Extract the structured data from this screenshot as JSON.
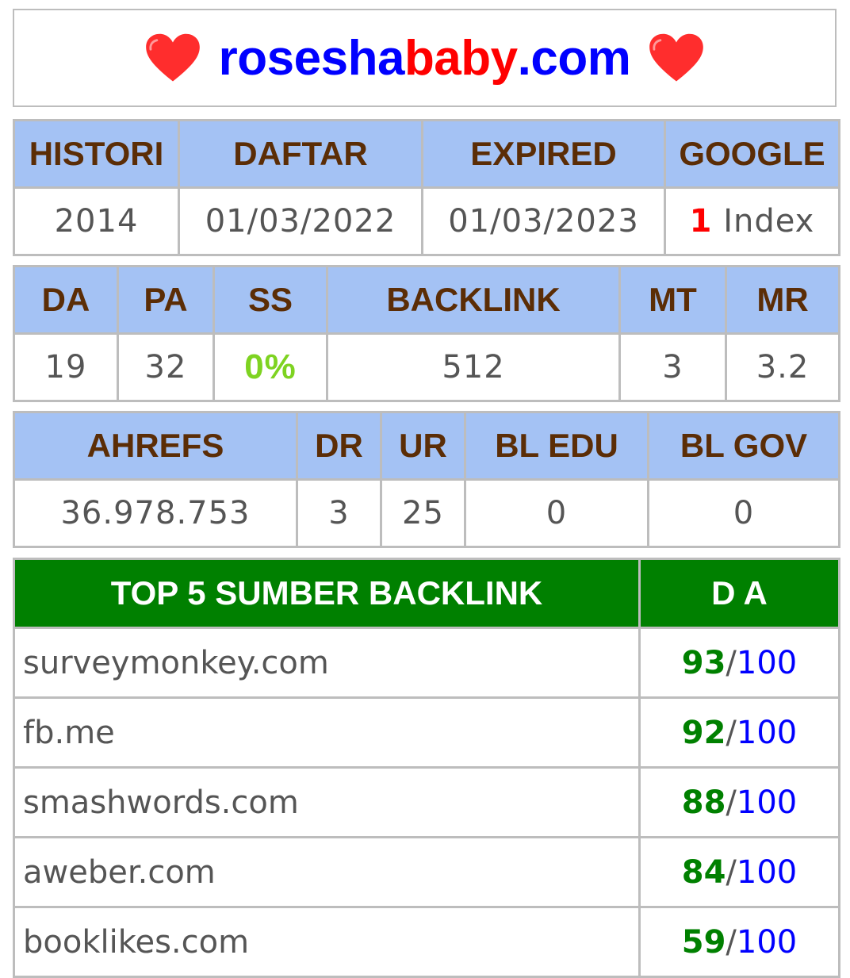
{
  "header": {
    "domain_part1": "rosesha",
    "domain_part2": "baby",
    "domain_part3": ".com",
    "icon": "heart-icon",
    "heart_color": "#ff2d2d"
  },
  "table1": {
    "headers": [
      "HISTORI",
      "DAFTAR",
      "EXPIRED",
      "GOOGLE"
    ],
    "values": {
      "histori": "2014",
      "daftar": "01/03/2022",
      "expired": "01/03/2023",
      "google_count": "1",
      "google_label": " Index"
    }
  },
  "table2": {
    "headers": [
      "DA",
      "PA",
      "SS",
      "BACKLINK",
      "MT",
      "MR"
    ],
    "values": {
      "da": "19",
      "pa": "32",
      "ss": "0%",
      "backlink": "512",
      "mt": "3",
      "mr": "3.2"
    }
  },
  "table3": {
    "headers": [
      "AHREFS",
      "DR",
      "UR",
      "BL EDU",
      "BL GOV"
    ],
    "values": [
      "36.978.753",
      "3",
      "25",
      "0",
      "0"
    ]
  },
  "top5": {
    "headers": [
      "TOP 5 SUMBER BACKLINK",
      "D A"
    ],
    "separator": "/",
    "max": "100",
    "rows": [
      {
        "site": "surveymonkey.com",
        "da": "93"
      },
      {
        "site": "fb.me",
        "da": "92"
      },
      {
        "site": "smashwords.com",
        "da": "88"
      },
      {
        "site": "aweber.com",
        "da": "84"
      },
      {
        "site": "booklikes.com",
        "da": "59"
      }
    ]
  },
  "colors": {
    "header_bg": "#a4c2f4",
    "header_text": "#5b2d06",
    "top5_header_bg": "#008000",
    "da_green": "#008000",
    "ss_green": "#7ed321",
    "blue": "#0000ff",
    "red": "#ff0000"
  }
}
